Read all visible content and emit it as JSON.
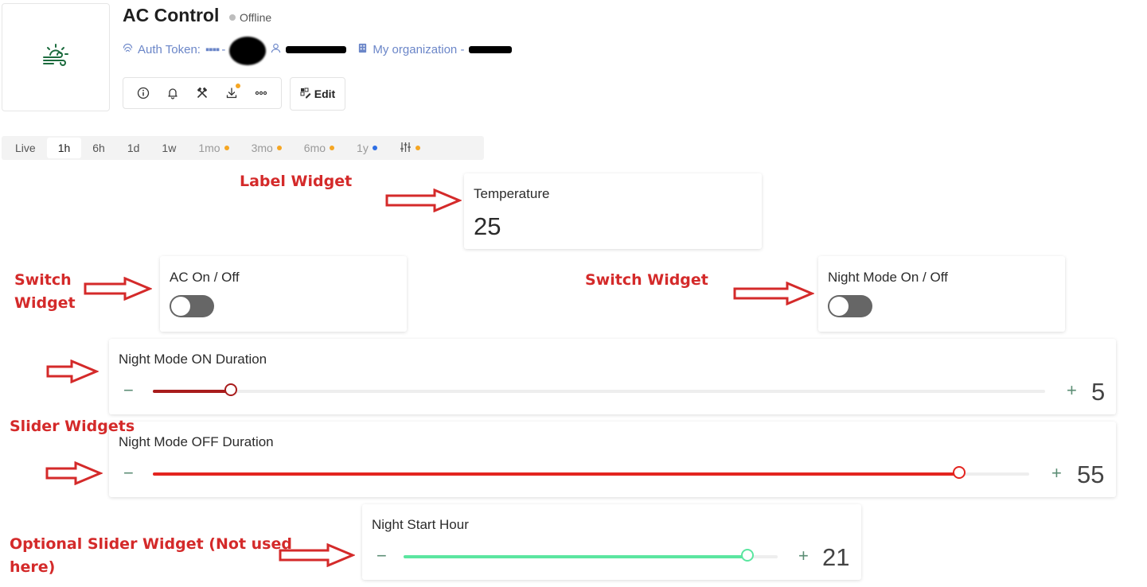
{
  "device": {
    "title": "AC Control",
    "status": "Offline",
    "auth_label": "Auth Token:",
    "auth_mask": "▪▪▪▪ -",
    "org_label": "My organization -",
    "icon": "weather-wind-sun-icon"
  },
  "toolbar": {
    "icons": [
      "info-icon",
      "bell-icon",
      "tools-icon",
      "download-icon",
      "more-icon"
    ],
    "edit_label": "Edit"
  },
  "time_ranges": [
    {
      "label": "Live"
    },
    {
      "label": "1h",
      "active": true
    },
    {
      "label": "6h"
    },
    {
      "label": "1d"
    },
    {
      "label": "1w"
    },
    {
      "label": "1mo",
      "dot": "#f5a623"
    },
    {
      "label": "3mo",
      "dot": "#f5a623"
    },
    {
      "label": "6mo",
      "dot": "#f5a623"
    },
    {
      "label": "1y",
      "dot": "#2f6fe4"
    }
  ],
  "widgets": {
    "temperature": {
      "title": "Temperature",
      "value": "25"
    },
    "ac_switch": {
      "title": "AC On / Off",
      "on": false
    },
    "night_switch": {
      "title": "Night Mode On / Off",
      "on": false
    },
    "night_on_duration": {
      "title": "Night Mode ON Duration",
      "minus": "−",
      "plus": "+",
      "value": "5",
      "fraction": 0.087,
      "color": "#a81c1c"
    },
    "night_off_duration": {
      "title": "Night Mode OFF Duration",
      "minus": "−",
      "plus": "+",
      "value": "55",
      "fraction": 0.92,
      "color": "#e3241f"
    },
    "night_start_hour": {
      "title": "Night Start Hour",
      "minus": "−",
      "plus": "+",
      "value": "21",
      "fraction": 0.92,
      "color": "#5be6a0"
    }
  },
  "annotations": {
    "label_widget": "Label Widget",
    "switch_widget_left": "Switch\nWidget",
    "switch_widget_right": "Switch Widget",
    "slider_widgets": "Slider Widgets",
    "optional_slider": "Optional Slider Widget (Not used\nhere)"
  },
  "colors": {
    "accent_link": "#6b86c8",
    "annotation": "#d42a2a",
    "switch_off": "#666666"
  }
}
